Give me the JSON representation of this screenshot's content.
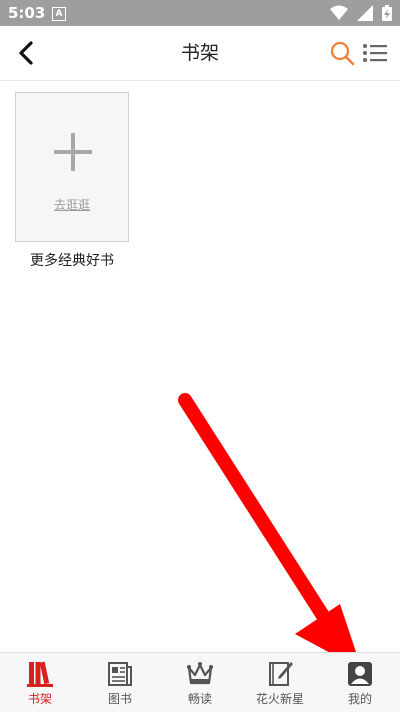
{
  "status_bar": {
    "time": "5:03",
    "notification_badge": "A"
  },
  "header": {
    "title": "书架"
  },
  "shelf": {
    "add_card_link": "去逛逛",
    "add_card_caption": "更多经典好书"
  },
  "tabs": [
    {
      "id": "bookshelf",
      "label": "书架",
      "icon": "bookshelf-icon",
      "active": true
    },
    {
      "id": "books",
      "label": "图书",
      "icon": "book-icon",
      "active": false
    },
    {
      "id": "reading",
      "label": "畅读",
      "icon": "crown-icon",
      "active": false
    },
    {
      "id": "new-stars",
      "label": "花火新星",
      "icon": "edit-notebook-icon",
      "active": false
    },
    {
      "id": "mine",
      "label": "我的",
      "icon": "user-profile-icon",
      "active": false
    }
  ],
  "colors": {
    "accent": "#d8201f",
    "search_icon": "#f07f33",
    "status_bar_bg": "#9e9e9e",
    "annotation_arrow": "#ff0000"
  }
}
